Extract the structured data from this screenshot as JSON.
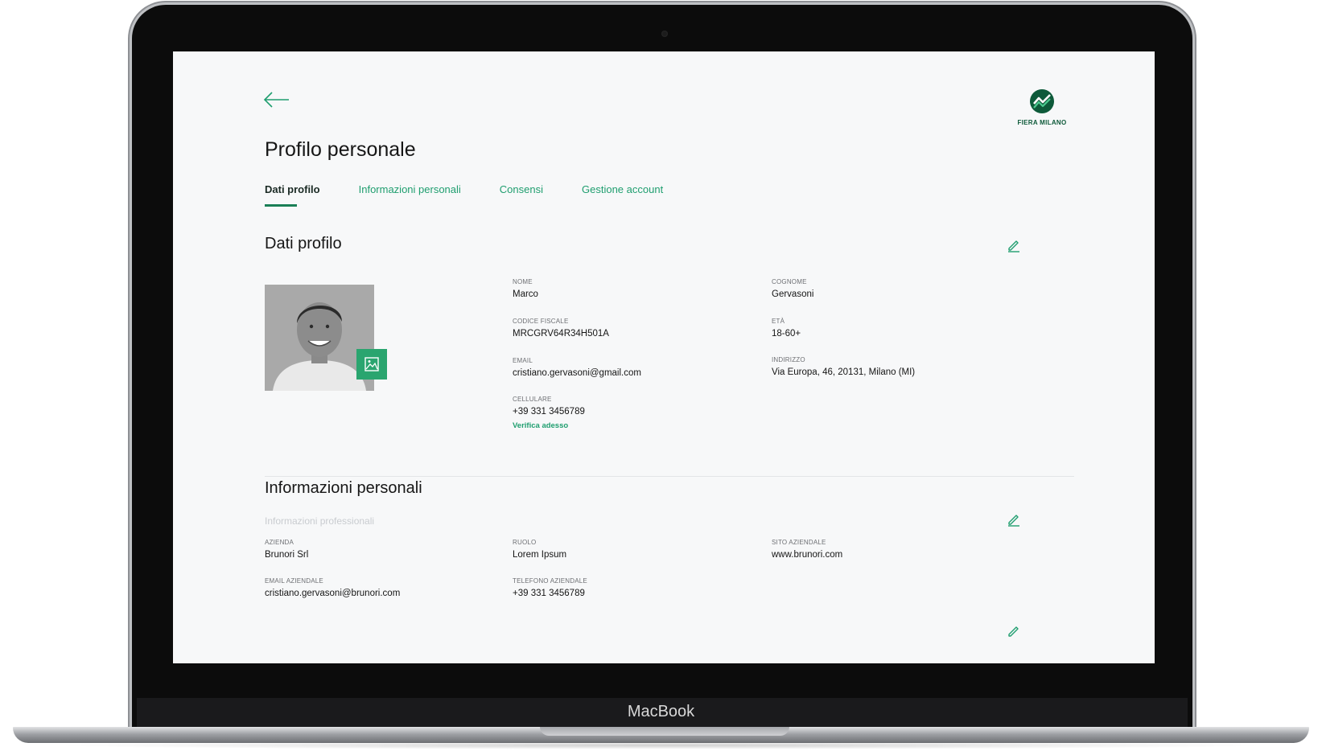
{
  "laptop": {
    "brand": "MacBook"
  },
  "header": {
    "back_icon": "arrow-left-icon",
    "logo": {
      "icon": "fiera-milano-logo",
      "text": "FIERA MILANO"
    },
    "page_title": "Profilo personale"
  },
  "tabs": [
    {
      "label": "Dati profilo",
      "active": true
    },
    {
      "label": "Informazioni personali",
      "active": false
    },
    {
      "label": "Consensi",
      "active": false
    },
    {
      "label": "Gestione account",
      "active": false
    }
  ],
  "profile": {
    "title": "Dati profilo",
    "edit_icon": "pencil-icon",
    "photo_change_icon": "image-icon",
    "fields": {
      "nome": {
        "label": "NOME",
        "value": "Marco"
      },
      "cognome": {
        "label": "COGNOME",
        "value": "Gervasoni"
      },
      "codice_fiscale": {
        "label": "CODICE FISCALE",
        "value": "MRCGRV64R34H501A"
      },
      "eta": {
        "label": "ETÀ",
        "value": "18-60+"
      },
      "email": {
        "label": "EMAIL",
        "value": "cristiano.gervasoni@gmail.com"
      },
      "indirizzo": {
        "label": "INDIRIZZO",
        "value": "Via Europa, 46, 20131, Milano (MI)"
      },
      "cellulare": {
        "label": "CELLULARE",
        "value": "+39 331 3456789",
        "verify_label": "Verifica adesso"
      }
    }
  },
  "personal": {
    "title": "Informazioni personali",
    "subtitle": "Informazioni professionali",
    "edit_icon": "pencil-icon",
    "fields": {
      "azienda": {
        "label": "AZIENDA",
        "value": "Brunori Srl"
      },
      "ruolo": {
        "label": "RUOLO",
        "value": "Lorem Ipsum"
      },
      "sito": {
        "label": "SITO AZIENDALE",
        "value": "www.brunori.com"
      },
      "email_aziendale": {
        "label": "EMAIL AZIENDALE",
        "value": "cristiano.gervasoni@brunori.com"
      },
      "telefono": {
        "label": "TELEFONO AZIENDALE",
        "value": "+39 331 3456789"
      }
    }
  },
  "colors": {
    "accent": "#1f9e6f",
    "dark_green": "#0e5a3a",
    "text": "#161616",
    "screen_bg": "#f7f8f9"
  }
}
